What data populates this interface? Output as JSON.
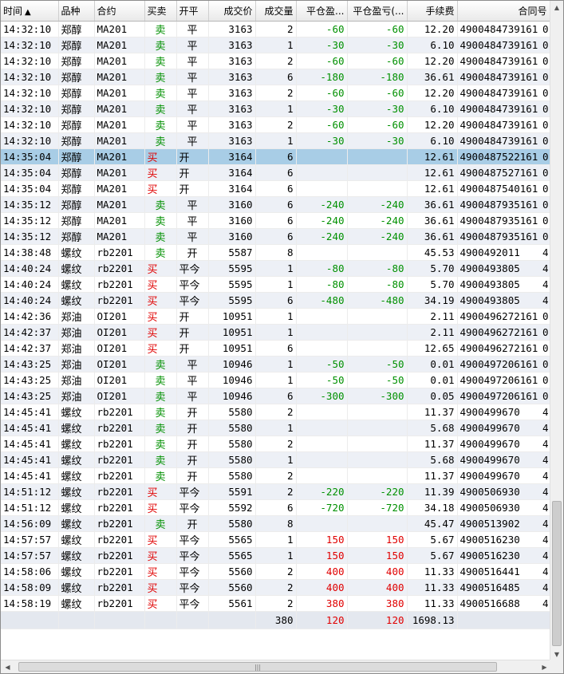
{
  "columns": [
    {
      "key": "time",
      "label": "时间",
      "sort": "▲"
    },
    {
      "key": "product",
      "label": "品种"
    },
    {
      "key": "contract",
      "label": "合约"
    },
    {
      "key": "direction",
      "label": "买卖"
    },
    {
      "key": "offset",
      "label": "开平"
    },
    {
      "key": "price",
      "label": "成交价"
    },
    {
      "key": "volume",
      "label": "成交量"
    },
    {
      "key": "close_pnl",
      "label": "平仓盈..."
    },
    {
      "key": "close_pnl2",
      "label": "平仓盈亏(..."
    },
    {
      "key": "fee",
      "label": "手续费"
    },
    {
      "key": "contract_no",
      "label": "合同号"
    }
  ],
  "rows": [
    {
      "time": "14:32:10",
      "product": "郑醇",
      "contract": "MA201",
      "direction": "卖",
      "offset": "平",
      "price": "3163",
      "volume": "2",
      "close_pnl": "-60",
      "close_pnl2": "-60",
      "fee": "12.20",
      "contract_no": "4900484739161",
      "extra": "0"
    },
    {
      "time": "14:32:10",
      "product": "郑醇",
      "contract": "MA201",
      "direction": "卖",
      "offset": "平",
      "price": "3163",
      "volume": "1",
      "close_pnl": "-30",
      "close_pnl2": "-30",
      "fee": "6.10",
      "contract_no": "4900484739161",
      "extra": "0"
    },
    {
      "time": "14:32:10",
      "product": "郑醇",
      "contract": "MA201",
      "direction": "卖",
      "offset": "平",
      "price": "3163",
      "volume": "2",
      "close_pnl": "-60",
      "close_pnl2": "-60",
      "fee": "12.20",
      "contract_no": "4900484739161",
      "extra": "0"
    },
    {
      "time": "14:32:10",
      "product": "郑醇",
      "contract": "MA201",
      "direction": "卖",
      "offset": "平",
      "price": "3163",
      "volume": "6",
      "close_pnl": "-180",
      "close_pnl2": "-180",
      "fee": "36.61",
      "contract_no": "4900484739161",
      "extra": "0"
    },
    {
      "time": "14:32:10",
      "product": "郑醇",
      "contract": "MA201",
      "direction": "卖",
      "offset": "平",
      "price": "3163",
      "volume": "2",
      "close_pnl": "-60",
      "close_pnl2": "-60",
      "fee": "12.20",
      "contract_no": "4900484739161",
      "extra": "0"
    },
    {
      "time": "14:32:10",
      "product": "郑醇",
      "contract": "MA201",
      "direction": "卖",
      "offset": "平",
      "price": "3163",
      "volume": "1",
      "close_pnl": "-30",
      "close_pnl2": "-30",
      "fee": "6.10",
      "contract_no": "4900484739161",
      "extra": "0"
    },
    {
      "time": "14:32:10",
      "product": "郑醇",
      "contract": "MA201",
      "direction": "卖",
      "offset": "平",
      "price": "3163",
      "volume": "2",
      "close_pnl": "-60",
      "close_pnl2": "-60",
      "fee": "12.20",
      "contract_no": "4900484739161",
      "extra": "0"
    },
    {
      "time": "14:32:10",
      "product": "郑醇",
      "contract": "MA201",
      "direction": "卖",
      "offset": "平",
      "price": "3163",
      "volume": "1",
      "close_pnl": "-30",
      "close_pnl2": "-30",
      "fee": "6.10",
      "contract_no": "4900484739161",
      "extra": "0"
    },
    {
      "time": "14:35:04",
      "product": "郑醇",
      "contract": "MA201",
      "direction": "买",
      "offset": "开",
      "price": "3164",
      "volume": "6",
      "close_pnl": "",
      "close_pnl2": "",
      "fee": "12.61",
      "contract_no": "4900487522161",
      "extra": "0",
      "selected": true
    },
    {
      "time": "14:35:04",
      "product": "郑醇",
      "contract": "MA201",
      "direction": "买",
      "offset": "开",
      "price": "3164",
      "volume": "6",
      "close_pnl": "",
      "close_pnl2": "",
      "fee": "12.61",
      "contract_no": "4900487527161",
      "extra": "0"
    },
    {
      "time": "14:35:04",
      "product": "郑醇",
      "contract": "MA201",
      "direction": "买",
      "offset": "开",
      "price": "3164",
      "volume": "6",
      "close_pnl": "",
      "close_pnl2": "",
      "fee": "12.61",
      "contract_no": "4900487540161",
      "extra": "0"
    },
    {
      "time": "14:35:12",
      "product": "郑醇",
      "contract": "MA201",
      "direction": "卖",
      "offset": "平",
      "price": "3160",
      "volume": "6",
      "close_pnl": "-240",
      "close_pnl2": "-240",
      "fee": "36.61",
      "contract_no": "4900487935161",
      "extra": "0"
    },
    {
      "time": "14:35:12",
      "product": "郑醇",
      "contract": "MA201",
      "direction": "卖",
      "offset": "平",
      "price": "3160",
      "volume": "6",
      "close_pnl": "-240",
      "close_pnl2": "-240",
      "fee": "36.61",
      "contract_no": "4900487935161",
      "extra": "0"
    },
    {
      "time": "14:35:12",
      "product": "郑醇",
      "contract": "MA201",
      "direction": "卖",
      "offset": "平",
      "price": "3160",
      "volume": "6",
      "close_pnl": "-240",
      "close_pnl2": "-240",
      "fee": "36.61",
      "contract_no": "4900487935161",
      "extra": "0"
    },
    {
      "time": "14:38:48",
      "product": "螺纹",
      "contract": "rb2201",
      "direction": "卖",
      "offset": "开",
      "price": "5587",
      "volume": "8",
      "close_pnl": "",
      "close_pnl2": "",
      "fee": "45.53",
      "contract_no": "4900492011",
      "extra": "4"
    },
    {
      "time": "14:40:24",
      "product": "螺纹",
      "contract": "rb2201",
      "direction": "买",
      "offset": "平今",
      "price": "5595",
      "volume": "1",
      "close_pnl": "-80",
      "close_pnl2": "-80",
      "fee": "5.70",
      "contract_no": "4900493805",
      "extra": "4"
    },
    {
      "time": "14:40:24",
      "product": "螺纹",
      "contract": "rb2201",
      "direction": "买",
      "offset": "平今",
      "price": "5595",
      "volume": "1",
      "close_pnl": "-80",
      "close_pnl2": "-80",
      "fee": "5.70",
      "contract_no": "4900493805",
      "extra": "4"
    },
    {
      "time": "14:40:24",
      "product": "螺纹",
      "contract": "rb2201",
      "direction": "买",
      "offset": "平今",
      "price": "5595",
      "volume": "6",
      "close_pnl": "-480",
      "close_pnl2": "-480",
      "fee": "34.19",
      "contract_no": "4900493805",
      "extra": "4"
    },
    {
      "time": "14:42:36",
      "product": "郑油",
      "contract": "OI201",
      "direction": "买",
      "offset": "开",
      "price": "10951",
      "volume": "1",
      "close_pnl": "",
      "close_pnl2": "",
      "fee": "2.11",
      "contract_no": "4900496272161",
      "extra": "0"
    },
    {
      "time": "14:42:37",
      "product": "郑油",
      "contract": "OI201",
      "direction": "买",
      "offset": "开",
      "price": "10951",
      "volume": "1",
      "close_pnl": "",
      "close_pnl2": "",
      "fee": "2.11",
      "contract_no": "4900496272161",
      "extra": "0"
    },
    {
      "time": "14:42:37",
      "product": "郑油",
      "contract": "OI201",
      "direction": "买",
      "offset": "开",
      "price": "10951",
      "volume": "6",
      "close_pnl": "",
      "close_pnl2": "",
      "fee": "12.65",
      "contract_no": "4900496272161",
      "extra": "0"
    },
    {
      "time": "14:43:25",
      "product": "郑油",
      "contract": "OI201",
      "direction": "卖",
      "offset": "平",
      "price": "10946",
      "volume": "1",
      "close_pnl": "-50",
      "close_pnl2": "-50",
      "fee": "0.01",
      "contract_no": "4900497206161",
      "extra": "0"
    },
    {
      "time": "14:43:25",
      "product": "郑油",
      "contract": "OI201",
      "direction": "卖",
      "offset": "平",
      "price": "10946",
      "volume": "1",
      "close_pnl": "-50",
      "close_pnl2": "-50",
      "fee": "0.01",
      "contract_no": "4900497206161",
      "extra": "0"
    },
    {
      "time": "14:43:25",
      "product": "郑油",
      "contract": "OI201",
      "direction": "卖",
      "offset": "平",
      "price": "10946",
      "volume": "6",
      "close_pnl": "-300",
      "close_pnl2": "-300",
      "fee": "0.05",
      "contract_no": "4900497206161",
      "extra": "0"
    },
    {
      "time": "14:45:41",
      "product": "螺纹",
      "contract": "rb2201",
      "direction": "卖",
      "offset": "开",
      "price": "5580",
      "volume": "2",
      "close_pnl": "",
      "close_pnl2": "",
      "fee": "11.37",
      "contract_no": "4900499670",
      "extra": "4"
    },
    {
      "time": "14:45:41",
      "product": "螺纹",
      "contract": "rb2201",
      "direction": "卖",
      "offset": "开",
      "price": "5580",
      "volume": "1",
      "close_pnl": "",
      "close_pnl2": "",
      "fee": "5.68",
      "contract_no": "4900499670",
      "extra": "4"
    },
    {
      "time": "14:45:41",
      "product": "螺纹",
      "contract": "rb2201",
      "direction": "卖",
      "offset": "开",
      "price": "5580",
      "volume": "2",
      "close_pnl": "",
      "close_pnl2": "",
      "fee": "11.37",
      "contract_no": "4900499670",
      "extra": "4"
    },
    {
      "time": "14:45:41",
      "product": "螺纹",
      "contract": "rb2201",
      "direction": "卖",
      "offset": "开",
      "price": "5580",
      "volume": "1",
      "close_pnl": "",
      "close_pnl2": "",
      "fee": "5.68",
      "contract_no": "4900499670",
      "extra": "4"
    },
    {
      "time": "14:45:41",
      "product": "螺纹",
      "contract": "rb2201",
      "direction": "卖",
      "offset": "开",
      "price": "5580",
      "volume": "2",
      "close_pnl": "",
      "close_pnl2": "",
      "fee": "11.37",
      "contract_no": "4900499670",
      "extra": "4"
    },
    {
      "time": "14:51:12",
      "product": "螺纹",
      "contract": "rb2201",
      "direction": "买",
      "offset": "平今",
      "price": "5591",
      "volume": "2",
      "close_pnl": "-220",
      "close_pnl2": "-220",
      "fee": "11.39",
      "contract_no": "4900506930",
      "extra": "4"
    },
    {
      "time": "14:51:12",
      "product": "螺纹",
      "contract": "rb2201",
      "direction": "买",
      "offset": "平今",
      "price": "5592",
      "volume": "6",
      "close_pnl": "-720",
      "close_pnl2": "-720",
      "fee": "34.18",
      "contract_no": "4900506930",
      "extra": "4"
    },
    {
      "time": "14:56:09",
      "product": "螺纹",
      "contract": "rb2201",
      "direction": "卖",
      "offset": "开",
      "price": "5580",
      "volume": "8",
      "close_pnl": "",
      "close_pnl2": "",
      "fee": "45.47",
      "contract_no": "4900513902",
      "extra": "4"
    },
    {
      "time": "14:57:57",
      "product": "螺纹",
      "contract": "rb2201",
      "direction": "买",
      "offset": "平今",
      "price": "5565",
      "volume": "1",
      "close_pnl": "150",
      "close_pnl2": "150",
      "fee": "5.67",
      "contract_no": "4900516230",
      "extra": "4"
    },
    {
      "time": "14:57:57",
      "product": "螺纹",
      "contract": "rb2201",
      "direction": "买",
      "offset": "平今",
      "price": "5565",
      "volume": "1",
      "close_pnl": "150",
      "close_pnl2": "150",
      "fee": "5.67",
      "contract_no": "4900516230",
      "extra": "4"
    },
    {
      "time": "14:58:06",
      "product": "螺纹",
      "contract": "rb2201",
      "direction": "买",
      "offset": "平今",
      "price": "5560",
      "volume": "2",
      "close_pnl": "400",
      "close_pnl2": "400",
      "fee": "11.33",
      "contract_no": "4900516441",
      "extra": "4"
    },
    {
      "time": "14:58:09",
      "product": "螺纹",
      "contract": "rb2201",
      "direction": "买",
      "offset": "平今",
      "price": "5560",
      "volume": "2",
      "close_pnl": "400",
      "close_pnl2": "400",
      "fee": "11.33",
      "contract_no": "4900516485",
      "extra": "4"
    },
    {
      "time": "14:58:19",
      "product": "螺纹",
      "contract": "rb2201",
      "direction": "买",
      "offset": "平今",
      "price": "5561",
      "volume": "2",
      "close_pnl": "380",
      "close_pnl2": "380",
      "fee": "11.33",
      "contract_no": "4900516688",
      "extra": "4"
    }
  ],
  "totals": {
    "volume": "380",
    "close_pnl": "120",
    "close_pnl2": "120",
    "fee": "1698.13"
  },
  "colors": {
    "buy": "#e00000",
    "sell": "#009000",
    "selected_row": "#a8cde6",
    "zebra_row": "#edf0f6"
  },
  "icons": {
    "scroll_up": "triangle-up-icon",
    "scroll_down": "triangle-down-icon",
    "scroll_left": "triangle-left-icon",
    "scroll_right": "triangle-right-icon",
    "grip": "grip-icon"
  }
}
